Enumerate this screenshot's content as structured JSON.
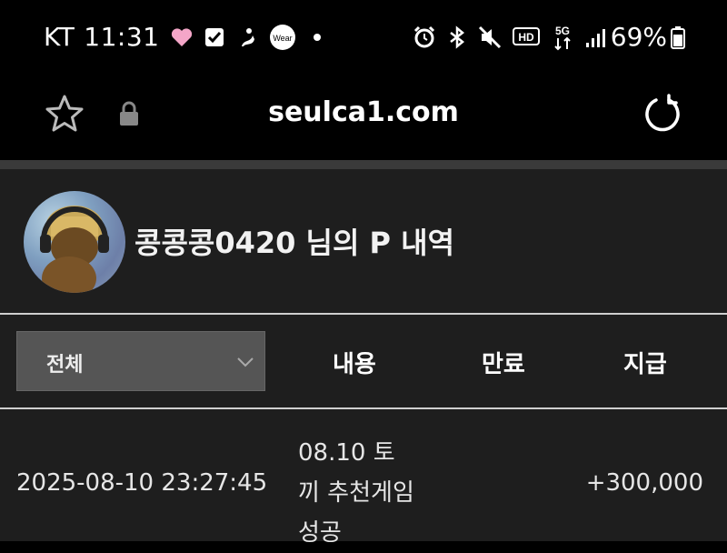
{
  "status_bar": {
    "carrier": "KT",
    "time": "11:31",
    "battery_percent": "69%",
    "left_icons": [
      "heart-icon",
      "check-square-icon",
      "activity-icon",
      "wear-icon",
      "dot-icon"
    ],
    "right_icons": [
      "alarm-icon",
      "bluetooth-icon",
      "mute-icon",
      "hd-icon",
      "5g-icon",
      "signal-icon",
      "battery-icon"
    ],
    "wear_label": "Wear",
    "hd_label": "HD",
    "fiveg_label": "5G",
    "heart_color": "#f4a6c8"
  },
  "browser": {
    "url": "seulca1.com"
  },
  "profile": {
    "title": "콩콩콩0420 님의 P 내역"
  },
  "filter": {
    "selected": "전체"
  },
  "table": {
    "headers": {
      "content": "내용",
      "expire": "만료",
      "pay": "지급"
    },
    "rows": [
      {
        "date": "2025-08-10 23:27:45",
        "description": "08.10 토끼 추천게임 성공",
        "amount": "+300,000"
      }
    ]
  }
}
